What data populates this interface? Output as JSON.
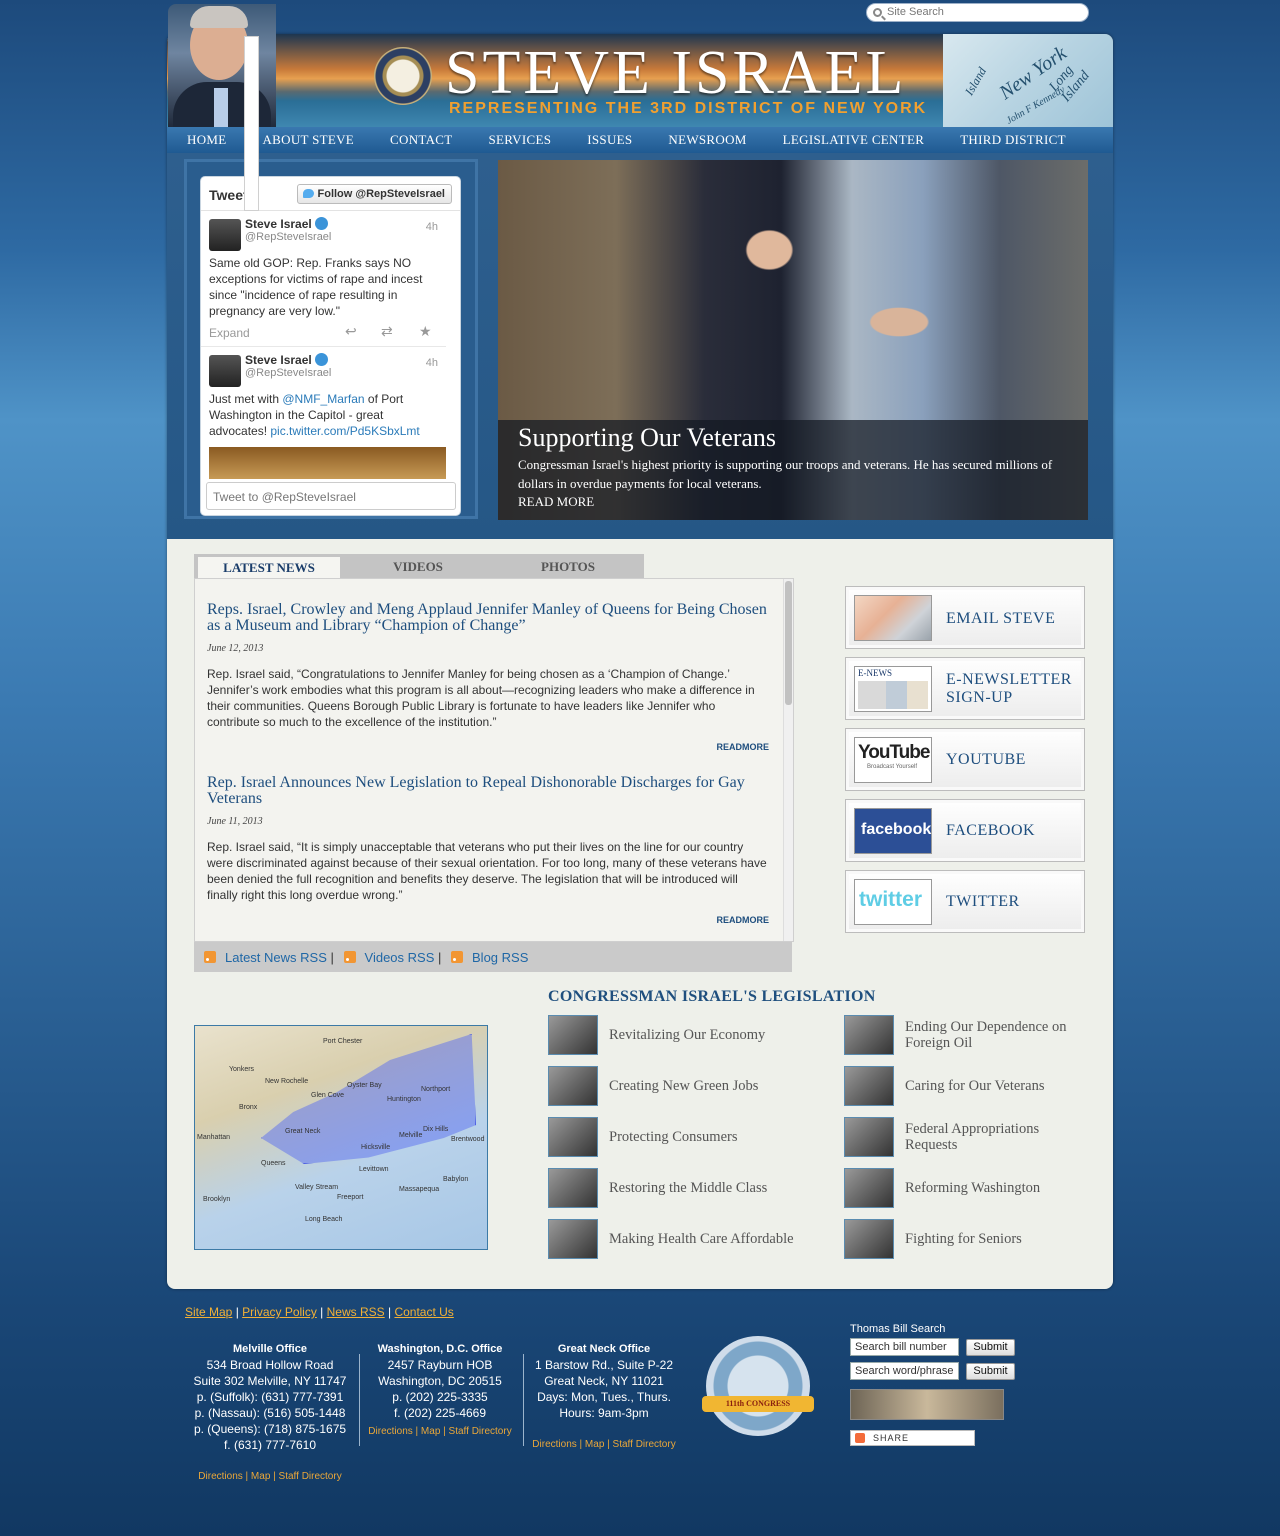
{
  "search": {
    "placeholder": "Site Search"
  },
  "header": {
    "name": "STEVE ISRAEL",
    "tagline": "REPRESENTING THE 3RD DISTRICT OF NEW YORK",
    "map_words": [
      "New York",
      "Long Island",
      "Island",
      "John F Kennedy"
    ]
  },
  "nav": [
    "HOME",
    "ABOUT STEVE",
    "CONTACT",
    "SERVICES",
    "ISSUES",
    "NEWSROOM",
    "LEGISLATIVE CENTER",
    "THIRD DISTRICT"
  ],
  "twitter": {
    "title": "Tweets",
    "follow_label": "Follow @RepSteveIsrael",
    "tweets": [
      {
        "name": "Steve Israel",
        "handle": "@RepSteveIsrael",
        "time": "4h",
        "text": "Same old GOP: Rep. Franks says NO exceptions for victims of rape and incest since \"incidence of rape resulting in pregnancy are very low.\"",
        "expand": "Expand"
      },
      {
        "name": "Steve Israel",
        "handle": "@RepSteveIsrael",
        "time": "4h",
        "text_a": "Just met with ",
        "text_link1": "@NMF_Marfan",
        "text_b": " of Port Washington in the Capitol - great advocates! ",
        "text_link2": "pic.twitter.com/Pd5KSbxLmt"
      }
    ],
    "input_placeholder": "Tweet to @RepSteveIsrael"
  },
  "hero": {
    "title": "Supporting Our Veterans",
    "text": "Congressman Israel's highest priority is supporting our troops and veterans. He has secured millions of dollars in overdue payments for local veterans.",
    "more": "READ MORE"
  },
  "tabs": [
    "LATEST NEWS",
    "VIDEOS",
    "PHOTOS"
  ],
  "news": [
    {
      "headline": "Reps. Israel, Crowley and Meng Applaud Jennifer Manley of Queens for Being Chosen as a Museum and Library “Champion of Change”",
      "date": "June 12, 2013",
      "body": "Rep. Israel said, “Congratulations to Jennifer Manley for being chosen as a ‘Champion of Change.’ Jennifer’s work embodies what this program is all about—recognizing leaders who make a difference in their communities. Queens Borough Public Library is fortunate to have leaders like Jennifer who contribute so much to the excellence of the institution.”",
      "readmore": "READMORE"
    },
    {
      "headline": "Rep. Israel Announces New Legislation to Repeal Dishonorable Discharges for Gay Veterans",
      "date": "June 11, 2013",
      "body": " Rep. Israel said, “It is simply unacceptable that veterans who put their lives on the line for our country were discriminated against because of their sexual orientation. For too long, many of these veterans have been denied the full recognition and benefits they deserve. The legislation that will be introduced will finally right this long overdue wrong.”",
      "readmore": "READMORE"
    }
  ],
  "rss": [
    "Latest News RSS",
    "Videos RSS",
    "Blog RSS"
  ],
  "rss_sep": "|",
  "side_buttons": [
    {
      "label": "EMAIL STEVE",
      "icon": "keyboard-typing-icon"
    },
    {
      "label": "E-NEWSLETTER SIGN-UP",
      "icon": "newsletter-icon",
      "thumb_text": "E-NEWS"
    },
    {
      "label": "YOUTUBE",
      "icon": "youtube-icon",
      "thumb_text": "YouTube",
      "thumb_sub": "Broadcast Yourself"
    },
    {
      "label": "FACEBOOK",
      "icon": "facebook-icon",
      "thumb_text": "facebook"
    },
    {
      "label": "TWITTER",
      "icon": "twitter-icon",
      "thumb_text": "twitter"
    }
  ],
  "legislation": {
    "title": "CONGRESSMAN ISRAEL'S LEGISLATION",
    "left": [
      "Revitalizing Our Economy",
      "Creating New Green Jobs",
      "Protecting Consumers",
      "Restoring the Middle Class",
      "Making Health Care Affordable"
    ],
    "right": [
      "Ending Our Dependence on Foreign Oil",
      "Caring for Our Veterans",
      "Federal Appropriations Requests",
      "Reforming Washington",
      "Fighting for Seniors"
    ]
  },
  "map_labels": [
    "Yonkers",
    "New Rochelle",
    "Bronx",
    "Manhattan",
    "Queens",
    "Brooklyn",
    "Glen Cove",
    "Huntington",
    "Great Neck",
    "Hicksville",
    "Levittown",
    "Freeport",
    "Long Beach",
    "Port Chester",
    "Oyster Bay",
    "Northport",
    "Melville",
    "Dix Hills",
    "Brentwood",
    "Valley Stream",
    "Massapequa",
    "Babylon"
  ],
  "footer": {
    "links": [
      "Site Map",
      "Privacy Policy",
      "News RSS",
      "Contact Us"
    ],
    "offices": [
      {
        "title": "Melville Office",
        "lines": [
          "534 Broad Hollow Road",
          "Suite 302 Melville, NY 11747",
          "p. (Suffolk): (631) 777-7391",
          "p. (Nassau): (516) 505-1448",
          "p. (Queens): (718) 875-1675",
          "f. (631) 777-7610"
        ]
      },
      {
        "title": "Washington, D.C. Office",
        "lines": [
          "2457 Rayburn HOB",
          "Washington, DC 20515",
          "p. (202) 225-3335",
          "f. (202) 225-4669"
        ]
      },
      {
        "title": "Great Neck Office",
        "lines": [
          "1 Barstow Rd., Suite P-22",
          "Great Neck, NY 11021",
          "Days: Mon, Tues., Thurs.",
          "Hours: 9am-3pm"
        ]
      }
    ],
    "office_links": [
      "Directions",
      "Map",
      "Staff Directory"
    ],
    "badge_text": "111th CONGRESS",
    "thomas": {
      "title": "Thomas Bill Search",
      "bill_placeholder": "Search bill number",
      "word_placeholder": "Search word/phrase",
      "submit": "Submit"
    },
    "share": "SHARE"
  }
}
